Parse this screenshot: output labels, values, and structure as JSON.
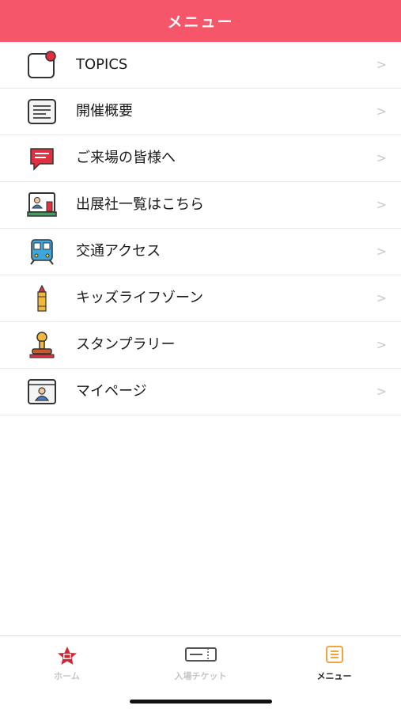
{
  "header": {
    "title": "メニュー"
  },
  "menu": {
    "chevron": ">",
    "items": [
      {
        "label": "TOPICS",
        "icon": "topics-notification-icon"
      },
      {
        "label": "開催概要",
        "icon": "document-list-icon"
      },
      {
        "label": "ご来場の皆様へ",
        "icon": "speech-bubble-icon"
      },
      {
        "label": "出展社一覧はこちら",
        "icon": "exhibitor-board-icon"
      },
      {
        "label": "交通アクセス",
        "icon": "train-icon"
      },
      {
        "label": "キッズライフゾーン",
        "icon": "crayon-icon"
      },
      {
        "label": "スタンプラリー",
        "icon": "stamp-icon"
      },
      {
        "label": "マイページ",
        "icon": "user-profile-icon"
      }
    ]
  },
  "tabbar": {
    "tabs": [
      {
        "label": "ホーム",
        "icon": "home-logo-icon",
        "active": false
      },
      {
        "label": "入場チケット",
        "icon": "ticket-icon",
        "active": false
      },
      {
        "label": "メニュー",
        "icon": "menu-list-icon",
        "active": true
      }
    ]
  },
  "colors": {
    "header_bg": "#f5566a",
    "accent": "#e0303f",
    "inactive_tab": "#c6c6c6"
  }
}
